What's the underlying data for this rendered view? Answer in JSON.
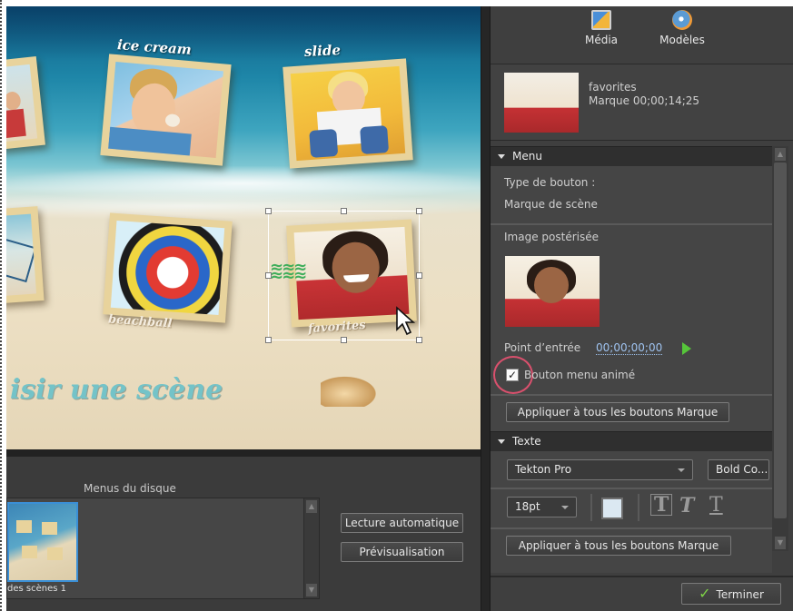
{
  "canvas": {
    "labels": {
      "icecream": "ice cream",
      "slide": "slide",
      "beachball": "beachball",
      "favorites": "favorites"
    },
    "scene_title": "isir une scène"
  },
  "disc_menus": {
    "label": "Menus du disque",
    "thumb_label": "des scènes 1",
    "autoplay_button": "Lecture automatique",
    "preview_button": "Prévisualisation"
  },
  "tabs": [
    {
      "label": "Média",
      "icon": "media-icon"
    },
    {
      "label": "Modèles",
      "icon": "templates-icon"
    }
  ],
  "selected_item": {
    "name": "favorites",
    "marker": "Marque 00;00;14;25"
  },
  "menu_section": {
    "title": "Menu",
    "button_type_label": "Type de bouton :",
    "button_type_value": "Marque de scène",
    "poster_label": "Image postérisée",
    "in_point_label": "Point d’entrée",
    "in_point_value": "00;00;00;00",
    "animated_checkbox_label": "Bouton menu animé",
    "animated_checked": true,
    "apply_button": "Appliquer à tous les boutons Marque"
  },
  "text_section": {
    "title": "Texte",
    "font_family": "Tekton Pro",
    "font_style": "Bold Co...",
    "font_size": "18pt",
    "text_color": "#dbe8f2",
    "apply_button": "Appliquer à tous les boutons Marque"
  },
  "footer": {
    "done_button": "Terminer"
  }
}
